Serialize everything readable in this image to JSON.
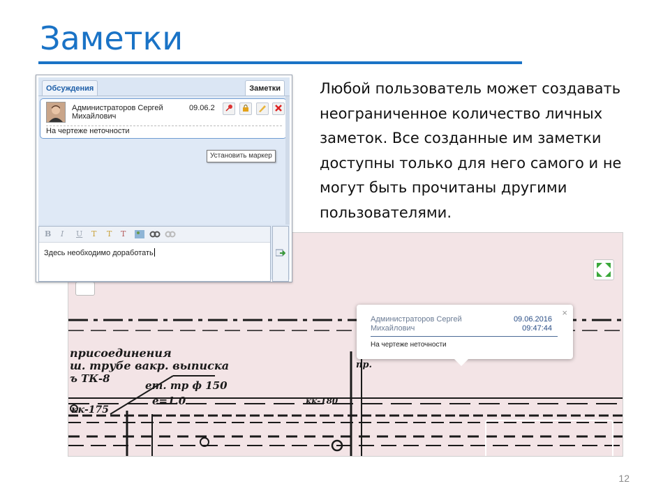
{
  "slide": {
    "title": "Заметки",
    "body": "Любой пользователь может создавать неограниченное количество личных заметок. Все созданные им заметки доступны только для него самого и не могут быть прочитаны другими пользователями.",
    "page_number": "12",
    "accent_color": "#1a73c6"
  },
  "panel": {
    "tabs": [
      {
        "label": "Обсуждения"
      },
      {
        "label": "Заметки"
      }
    ],
    "note": {
      "author": "Администраторов Сергей Михайлович",
      "date": "09.06.2",
      "text": "На чертеже неточности",
      "actions": [
        "pin-icon",
        "lock-icon",
        "edit-icon",
        "delete-icon"
      ]
    },
    "tooltip": "Установить маркер",
    "editor": {
      "toolbar": [
        "B",
        "I",
        "U",
        "T",
        "T",
        "T"
      ],
      "text": "Здесь необходимо доработать"
    }
  },
  "drawing": {
    "popup": {
      "author_line1": "Администраторов Сергей",
      "author_line2": "Михайлович",
      "date": "09.06.2016",
      "time": "09:47:44",
      "text": "На чертеже неточности",
      "close": "×"
    },
    "handwriting": {
      "line1": "присоединения",
      "line2": "ш. трубе вакр. выписка",
      "line3": "ъ ТК-8",
      "label1": "ет. тр ф 150",
      "label2": "е=1.0",
      "label3": "кк-175",
      "label4": "кк-180",
      "label5": "пр."
    }
  }
}
